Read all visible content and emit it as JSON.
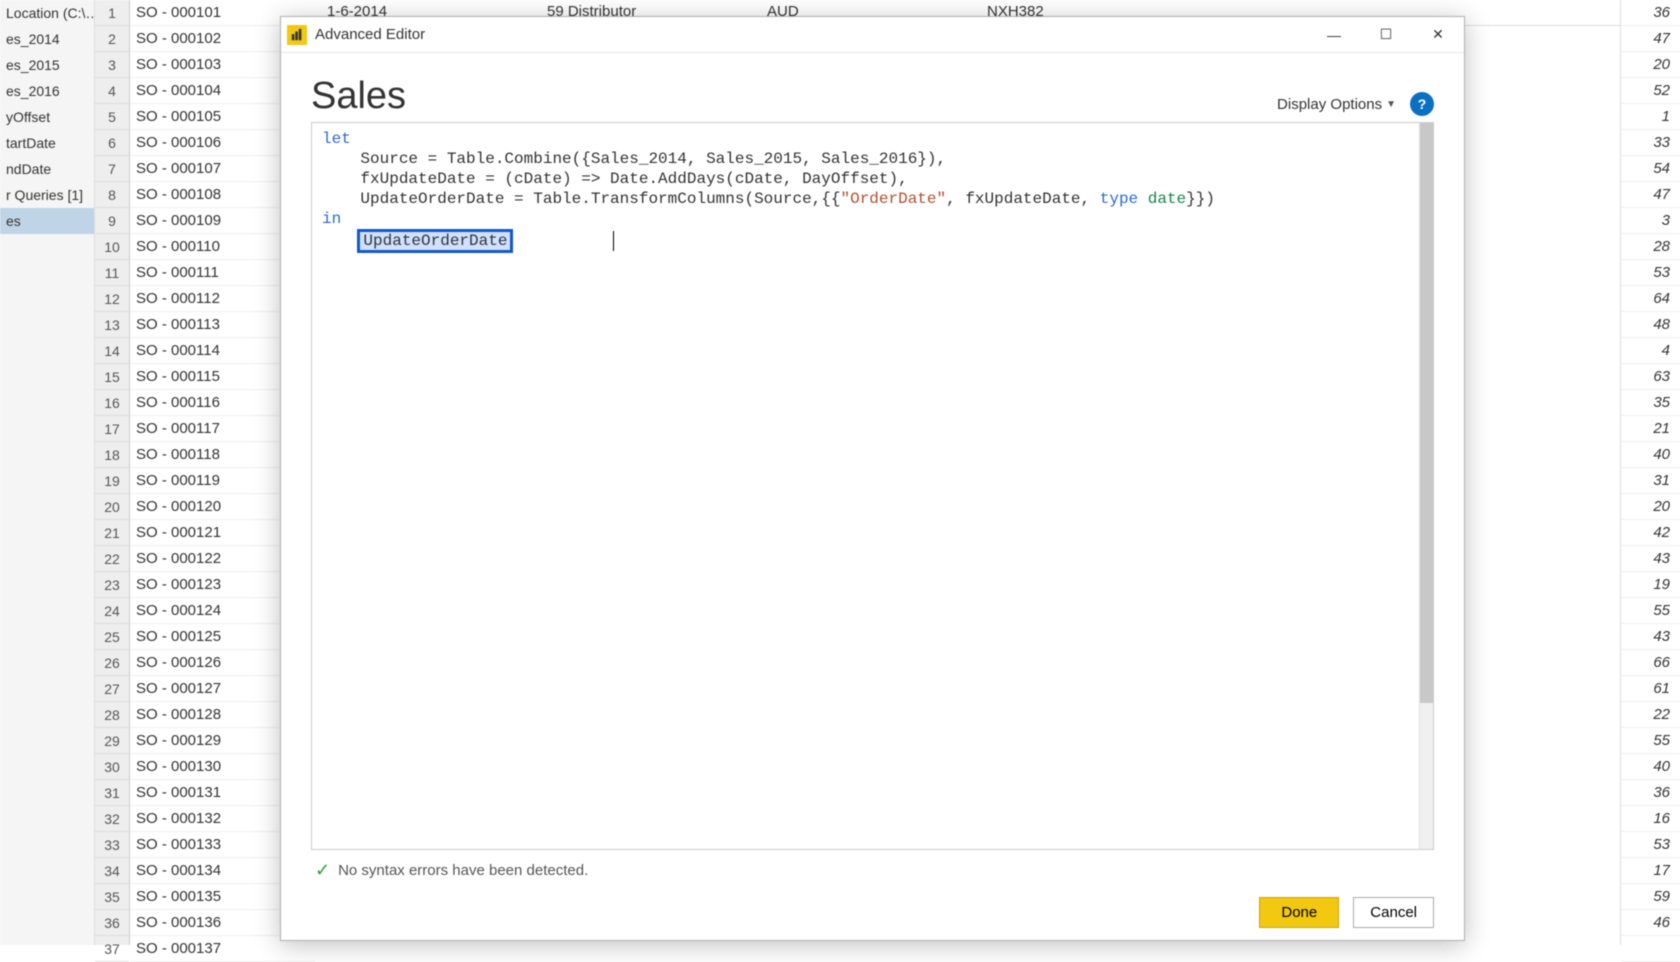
{
  "nav_panel": {
    "items": [
      "Location (C:\\…",
      "es_2014",
      "es_2015",
      "es_2016",
      "yOffset",
      "tartDate",
      "ndDate",
      "r Queries [1]",
      "es"
    ],
    "selected_index": 8
  },
  "bg_table": {
    "header": {
      "date": "1-6-2014",
      "distributor": "59  Distributor",
      "currency": "AUD",
      "code": "NXH382"
    },
    "rows": [
      {
        "n": 1,
        "so": "SO - 000101",
        "r": 36
      },
      {
        "n": 2,
        "so": "SO - 000102",
        "r": 47
      },
      {
        "n": 3,
        "so": "SO - 000103",
        "r": 20
      },
      {
        "n": 4,
        "so": "SO - 000104",
        "r": 52
      },
      {
        "n": 5,
        "so": "SO - 000105",
        "r": 1
      },
      {
        "n": 6,
        "so": "SO - 000106",
        "r": 33
      },
      {
        "n": 7,
        "so": "SO - 000107",
        "r": 54
      },
      {
        "n": 8,
        "so": "SO - 000108",
        "r": 47
      },
      {
        "n": 9,
        "so": "SO - 000109",
        "r": 3
      },
      {
        "n": 10,
        "so": "SO - 000110",
        "r": 28
      },
      {
        "n": 11,
        "so": "SO - 000111",
        "r": 53
      },
      {
        "n": 12,
        "so": "SO - 000112",
        "r": 64
      },
      {
        "n": 13,
        "so": "SO - 000113",
        "r": 48
      },
      {
        "n": 14,
        "so": "SO - 000114",
        "r": 4
      },
      {
        "n": 15,
        "so": "SO - 000115",
        "r": 63
      },
      {
        "n": 16,
        "so": "SO - 000116",
        "r": 35
      },
      {
        "n": 17,
        "so": "SO - 000117",
        "r": 21
      },
      {
        "n": 18,
        "so": "SO - 000118",
        "r": 40
      },
      {
        "n": 19,
        "so": "SO - 000119",
        "r": 31
      },
      {
        "n": 20,
        "so": "SO - 000120",
        "r": 20
      },
      {
        "n": 21,
        "so": "SO - 000121",
        "r": 42
      },
      {
        "n": 22,
        "so": "SO - 000122",
        "r": 43
      },
      {
        "n": 23,
        "so": "SO - 000123",
        "r": 19
      },
      {
        "n": 24,
        "so": "SO - 000124",
        "r": 55
      },
      {
        "n": 25,
        "so": "SO - 000125",
        "r": 43
      },
      {
        "n": 26,
        "so": "SO - 000126",
        "r": 66
      },
      {
        "n": 27,
        "so": "SO - 000127",
        "r": 61
      },
      {
        "n": 28,
        "so": "SO - 000128",
        "r": 22
      },
      {
        "n": 29,
        "so": "SO - 000129",
        "r": 55
      },
      {
        "n": 30,
        "so": "SO - 000130",
        "r": 40
      },
      {
        "n": 31,
        "so": "SO - 000131",
        "r": 36
      },
      {
        "n": 32,
        "so": "SO - 000132",
        "r": 16
      },
      {
        "n": 33,
        "so": "SO - 000133",
        "r": 53
      },
      {
        "n": 34,
        "so": "SO - 000134",
        "r": 17
      },
      {
        "n": 35,
        "so": "SO - 000135",
        "r": 59
      },
      {
        "n": 36,
        "so": "SO - 000136",
        "r": 46
      },
      {
        "n": 37,
        "so": "SO - 000137",
        "r": ""
      }
    ]
  },
  "editor": {
    "window_title": "Advanced Editor",
    "query_name": "Sales",
    "display_options_label": "Display Options",
    "help_label": "?",
    "code": {
      "let": "let",
      "l1a": "    Source = Table.Combine({Sales_2014, Sales_2015, Sales_2016}),",
      "l2a": "    fxUpdateDate = (cDate) => Date.AddDays(cDate, DayOffset),",
      "l3a": "    UpdateOrderDate = Table.TransformColumns(Source,{{",
      "l3str": "\"OrderDate\"",
      "l3b": ", fxUpdateDate, ",
      "l3type": "type",
      "l3typename": " date",
      "l3c": "}})",
      "in": "in",
      "result": "UpdateOrderDate"
    },
    "status": "No syntax errors have been detected.",
    "done": "Done",
    "cancel": "Cancel"
  }
}
